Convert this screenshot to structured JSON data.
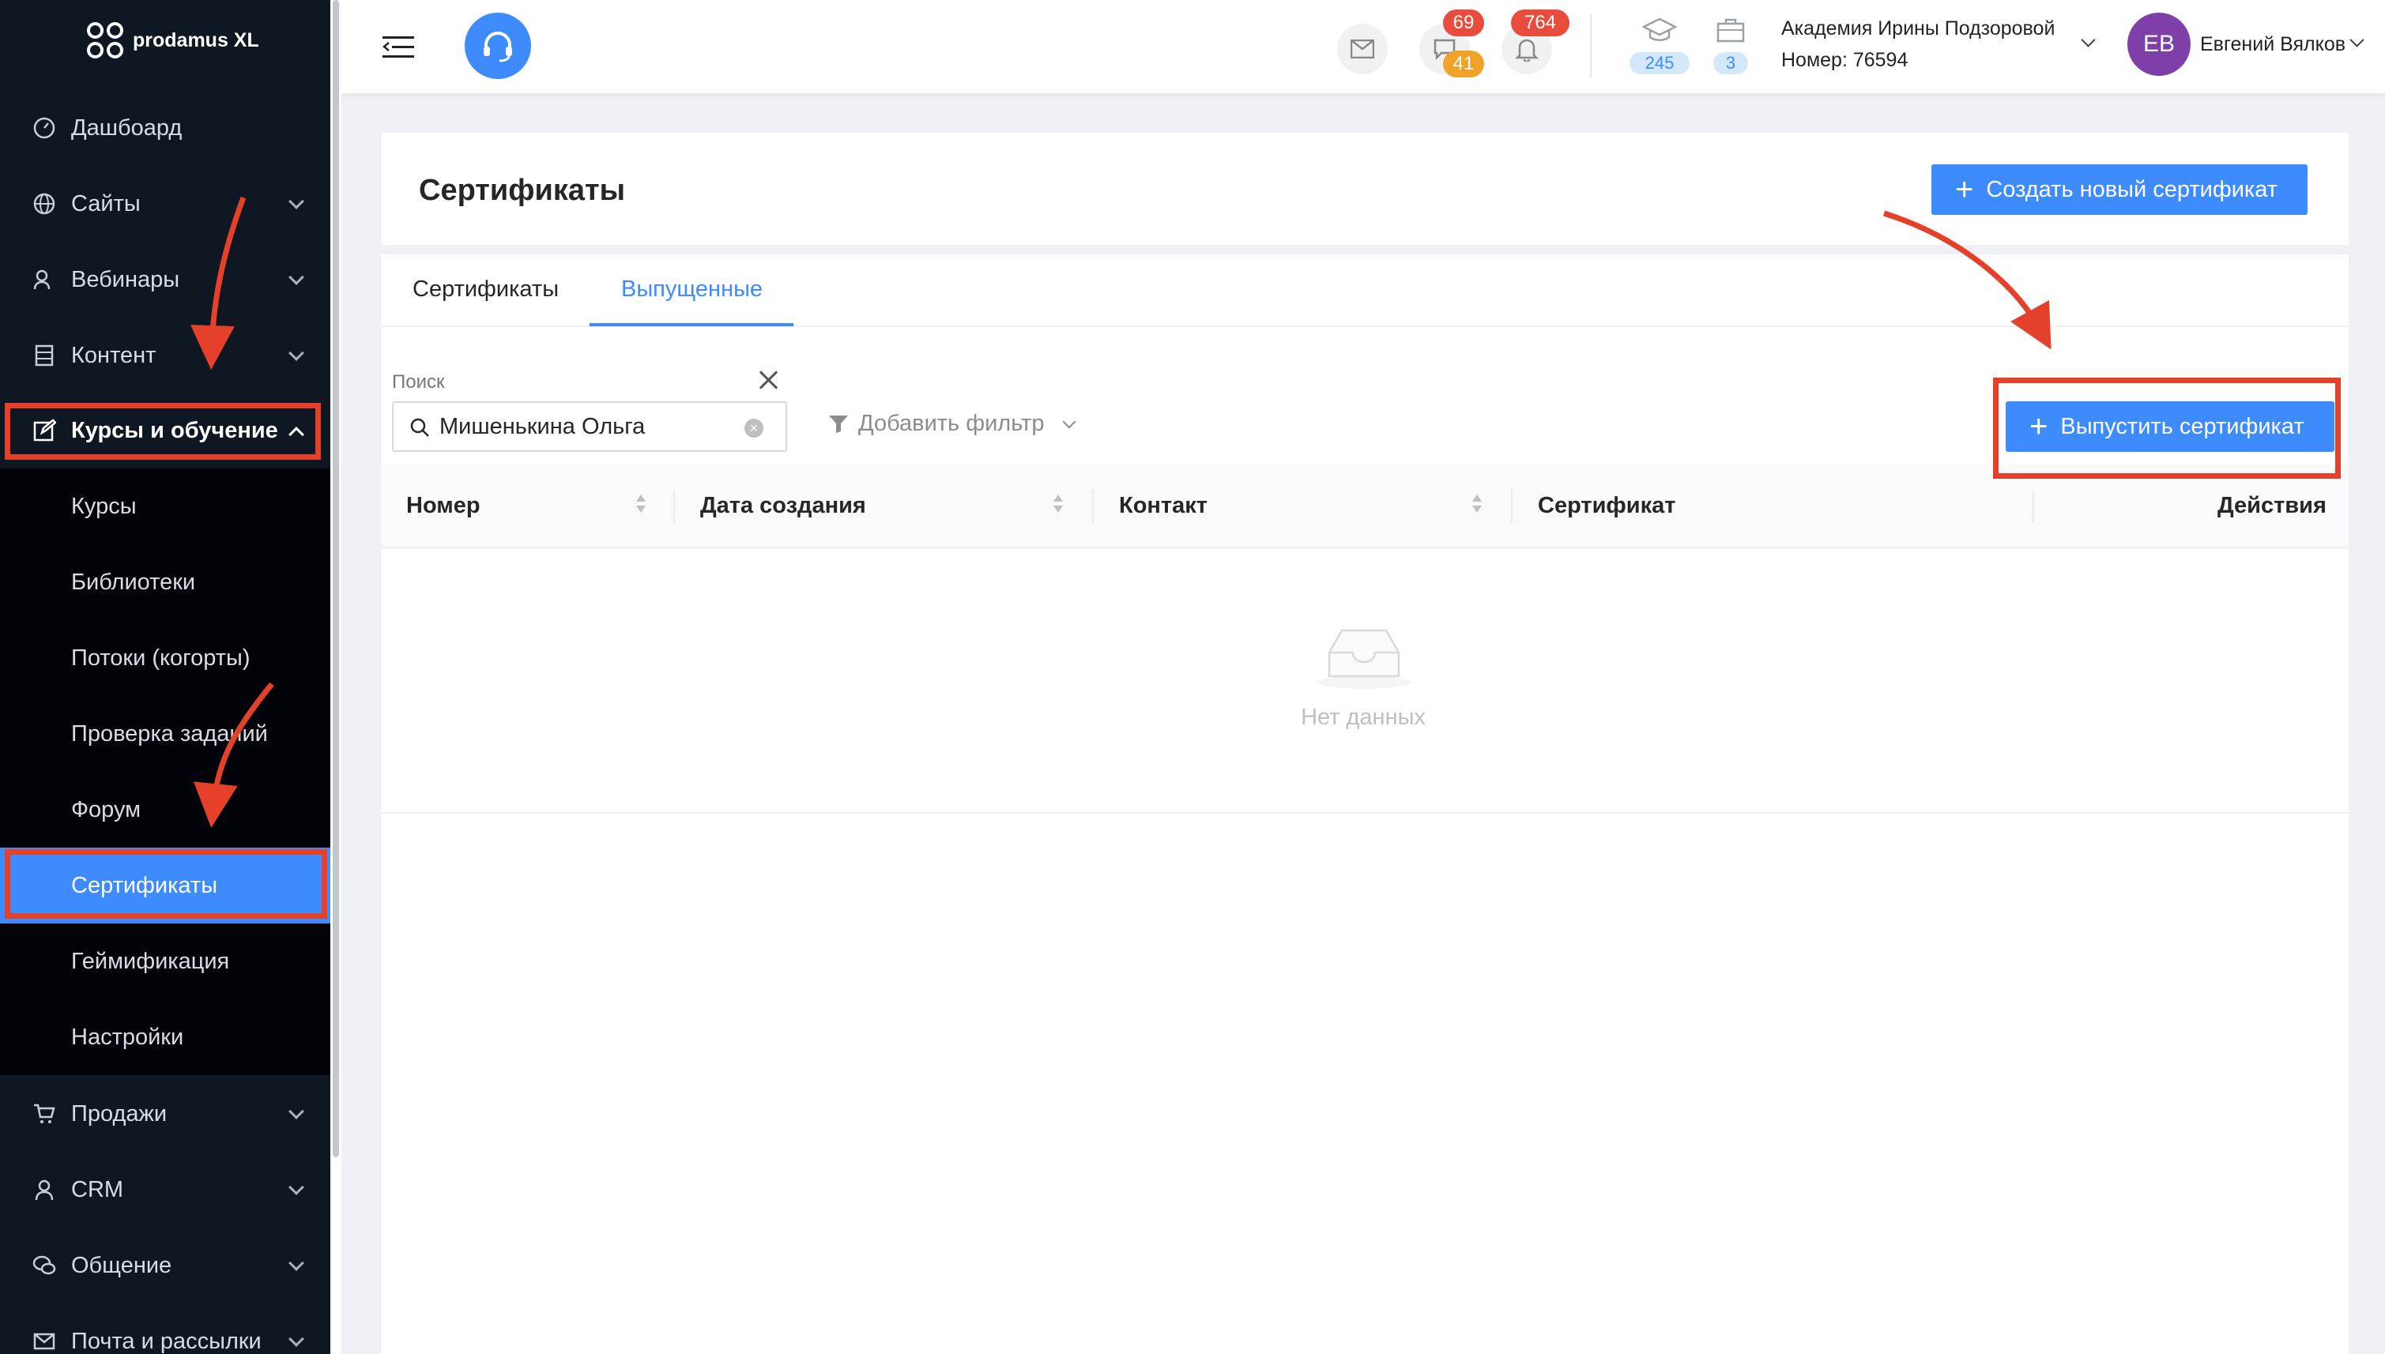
{
  "brand": {
    "name": "prodamus XL"
  },
  "sidebar": {
    "items": [
      {
        "label": "Дашбоард",
        "icon": "dashboard-icon"
      },
      {
        "label": "Сайты",
        "icon": "globe-icon"
      },
      {
        "label": "Вебинары",
        "icon": "webinar-icon"
      },
      {
        "label": "Контент",
        "icon": "content-icon"
      },
      {
        "label": "Курсы и обучение",
        "icon": "edit-icon"
      },
      {
        "label": "Продажи",
        "icon": "cart-icon"
      },
      {
        "label": "CRM",
        "icon": "user-icon"
      },
      {
        "label": "Общение",
        "icon": "chat-icon"
      },
      {
        "label": "Почта и рассылки",
        "icon": "mail-icon"
      }
    ],
    "submenu": [
      {
        "label": "Курсы"
      },
      {
        "label": "Библиотеки"
      },
      {
        "label": "Потоки (когорты)"
      },
      {
        "label": "Проверка заданий"
      },
      {
        "label": "Форум"
      },
      {
        "label": "Сертификаты"
      },
      {
        "label": "Геймификация"
      },
      {
        "label": "Настройки"
      }
    ]
  },
  "header": {
    "badges": {
      "chat_top": "69",
      "chat_bottom": "41",
      "notifications": "764"
    },
    "counters": {
      "students": "245",
      "cases": "3"
    },
    "org": {
      "name": "Академия Ирины Подзоровой",
      "number": "Номер: 76594"
    },
    "user": {
      "initials": "ЕВ",
      "name": "Евгений Вялков"
    }
  },
  "page": {
    "title": "Сертификаты",
    "create_button": "Создать новый сертификат",
    "tabs": [
      {
        "label": "Сертификаты"
      },
      {
        "label": "Выпущенные"
      }
    ],
    "search": {
      "label": "Поиск",
      "value": "Мишенькина Ольга"
    },
    "filter_button": "Добавить фильтр",
    "issue_button": "Выпустить сертификат",
    "table": {
      "columns": [
        "Номер",
        "Дата создания",
        "Контакт",
        "Сертификат",
        "Действия"
      ],
      "empty_text": "Нет данных"
    }
  },
  "colors": {
    "accent": "#3d8bfd",
    "sidebar_bg": "#0f1723",
    "annotation": "#e5402a"
  }
}
